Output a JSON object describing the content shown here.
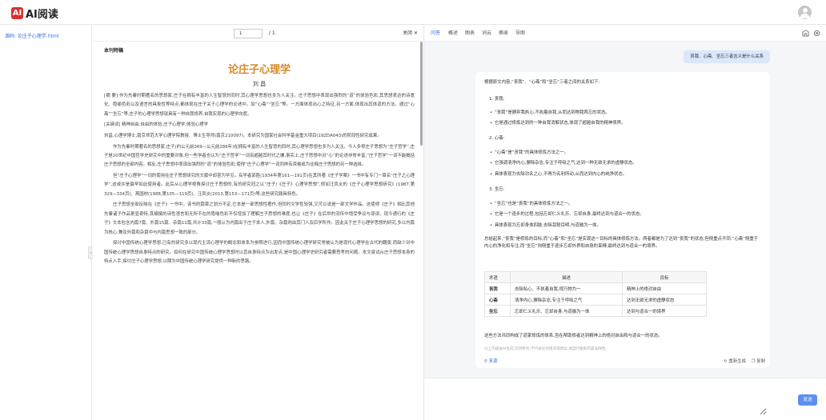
{
  "app": {
    "logo_mark": "AI",
    "name": "AI阅读",
    "logo_icon": "ai-logo-icon",
    "user_icon": "user-avatar-icon"
  },
  "sidebar": {
    "file_label": "源码: 论庄子心理学.html"
  },
  "doc_toolbar": {
    "page_value": "1",
    "page_total": "/   1",
    "close_label": "关闭 ✕"
  },
  "document": {
    "journal": "本刊特稿",
    "title": "论庄子心理学",
    "author": "刘 昌",
    "paragraphs": [
      "[摘 要] 作为先秦时期著名的思想家,庄子在拥有丰富的人生智慧的同时,其心理学思想也多为人关注。庄子思想中表现出强烈的“道”的体验色彩,其思想表达的诗意化、隐喻色彩以及语言的具象性等特点,都体现在庄子关于心理学的论述中。如“心斋”“坐忘”等。一方面体现出心之特征,另一方面,体现出其体道的方法。通过“心斋”“坐忘”等,庄子的心理学思想就具有一种自我修养,自我实现的心理学向度。",
      "[关键词] 精神自由;自由的体验;庄子心理学;体验心理学",
      "刘昌,心理学博士,南京师范大学心理学院教授、博士生导师(南京210097)。本研究为国家社会科学基金重大项目(19ZDA043)的阶段性研究成果。",
      "作为先秦时期著名的思想家,庄子(约公元前369—公元前286年)在拥有丰富的人生智慧的同时,其心理学思想也多为人关注。今人多称庄子思想为“庄子哲学”,庄子是20世纪中国哲学史研究中的重要对象,但一些学者也认为“庄子哲学”一词有超越其时代之嫌,事实上,庄子思想中对“心”的论述非常丰富,“庄子哲学”一词不能概括庄子思想的全部内容。相反,庄子思想中表现出强烈的“道”的体验色彩,使得“庄子心理学”一词同样有资格成为诠释庄子思想的另一种选择。",
      "但“庄子心理学”一词的使用在庄子思想研究的文献中却甚为罕见。有学者郭胜(1934年第161—191页)在其所著《庄子学案》一书中有专门一章名“庄子之心理学”,这或许是最早如此使用者。此后从心理学视角探讨庄子思想的,有的研究冠之以“庄子/《庄子》心理学思想”,例如汪凤炎的《庄子心理学思想研究》(1987,第329—334页)、燕国材(1988,第105—119页)、汪凤炎(2013,第153—171页)等,这些研究颇具特色。",
      "庄子思想全部反映在《庄子》一书中。该书的篇章之划分不定,它本是一部思想性著作,但同时文学性较强,又可以说是一部文学作品。这使得《庄子》相比其他先秦诸子作品更显奇特,其编撰的诗性语言和无所不在的隐喻色彩不仅增加了理解庄子思想的难度,也让《庄子》在后世的流传中饱受争议与误读。现今通行的《庄子》文本包含内篇7篇、外篇15篇、杂篇11篇,共计33篇,一般认为内篇出于庄子本人,外篇、杂篇则由其门人及后学所作。因此关于庄子心理学思想的研究,多以内篇为核心,兼及外篇和杂篇中与内篇思想一致的部分。",
      "探讨中国传统心理学思想,已有的研究多以现代主流心理学的概念和体系为参照进行,因而中国传统心理学研究常被认为是现代心理学在古代的翻版,而缺少对中国传统心理学思想自身特点的研究。如何在研究中国传统心理学思想时以其自身特点为出发点,是中国心理学史研究者需要思考的问题。本文尝试从庄子思想本身的特点入手,探讨庄子心理学思想,以期为中国传统心理学研究提供一种新的思路。"
    ]
  },
  "chat_tabs": [
    "问答",
    "概述",
    "图表",
    "词云",
    "摘录",
    "导图"
  ],
  "chat": {
    "question": "哀我、心斋、坐忘三者含义是什么关系",
    "intro": "根据原文内容,“丧我”、“心斋”和“坐忘”三者之间的关系如下:",
    "sections": [
      {
        "heading": "1. 丧我:",
        "points": [
          "“丧我”是摒弃我执心,不执着自我,从而达到物我两忘的状态。",
          "它是通过修炼达到的一种自我消解状态,体现了超越自我的精神境界。"
        ]
      },
      {
        "heading": "2. 心斋:",
        "points": [
          "“心斋”是“丧我”的具体修炼方法之一。",
          "它强调清净内心,摒除杂念,专注于呼吸之气,达到一种无欲无求的虚静状态。",
          "具体表现为去除功名之心,不再为名利所动,从而达到内心的纯净状态。"
        ]
      },
      {
        "heading": "3. 坐忘:",
        "points": [
          "“坐忘”也是“丧我”的具体修炼方法之一。",
          "它是一个逐步的过程,包括忘却仁义礼乐、忘却自身,最终达到与道合一的状态。",
          "具体表现为忘却身体四肢,去除耳聪目明,与道融为一体。"
        ]
      }
    ],
    "summary": "总结起来,“丧我”是修炼的目标,而“心斋”和“坐忘”是实现这一目标的具体修炼方法。两者都是为了达到“丧我”的状态,但侧重点不同:“心斋”侧重于内心的净化和专注,而“坐忘”则侧重于逐步忘却外界和自身的束缚,最终达到与道合一的境界。",
    "table": {
      "headers": [
        "术语",
        "描述",
        "目标"
      ],
      "rows": [
        [
          "丧我",
          "去除私心、不执着自我,视万物为一",
          "精神上的绝对自由"
        ],
        [
          "心斋",
          "清净内心,摒除杂念,专注于呼吸之气",
          "达到无欲无求的虚静状态"
        ],
        [
          "坐忘",
          "忘却仁义礼乐、忘却自身,与道融为一体",
          "达到与道合一的境界"
        ]
      ]
    },
    "conclusion": "这些方法共同构成了道家修炼的体系,旨在帮助修者达到精神上的绝对自由和与道合一的状态。",
    "disclaimer": "以上内容由AI生成,仅供参考,不代表任何观点或建议,请自行甄别内容准确性。",
    "source_label": "来源",
    "regen_label": "重新生成",
    "copy_label": "复制",
    "input_placeholder": "",
    "send_label": "发送"
  }
}
